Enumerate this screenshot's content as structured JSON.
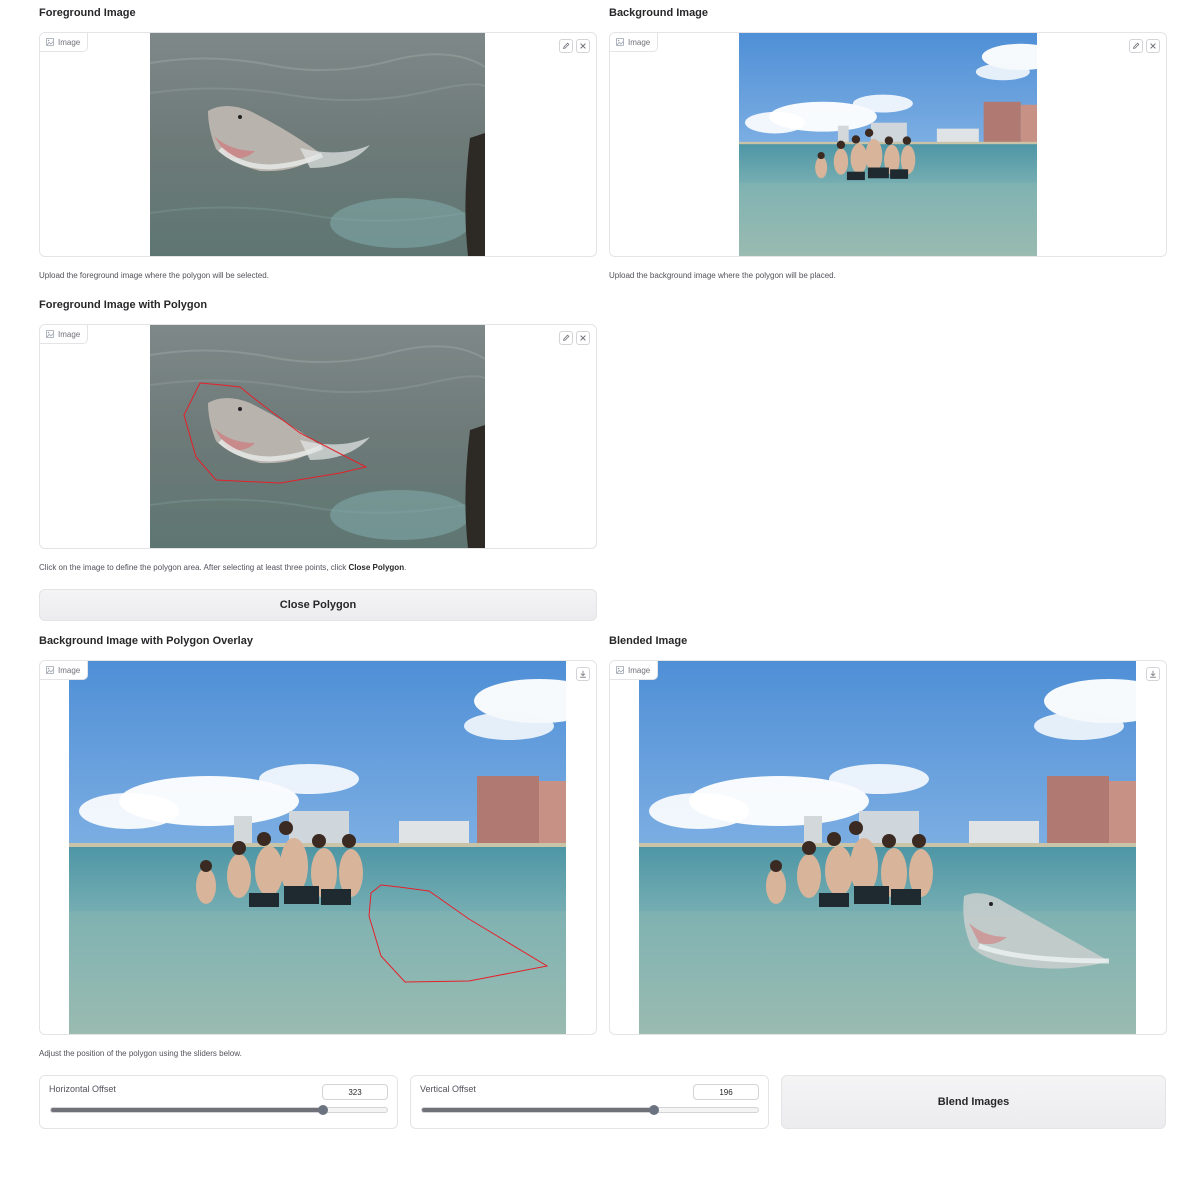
{
  "foreground": {
    "label": "Foreground Image",
    "badge": "Image",
    "hint": "Upload the foreground image where the polygon will be selected."
  },
  "background": {
    "label": "Background Image",
    "badge": "Image",
    "hint": "Upload the background image where the polygon will be placed."
  },
  "polygon_panel": {
    "label": "Foreground Image with Polygon",
    "badge": "Image",
    "hint_prefix": "Click on the image to define the polygon area. After selecting at least three points, click ",
    "hint_bold": "Close Polygon",
    "hint_suffix": "."
  },
  "close_polygon_button": "Close Polygon",
  "overlay_panel": {
    "label": "Background Image with Polygon Overlay",
    "badge": "Image"
  },
  "blended_panel": {
    "label": "Blended Image",
    "badge": "Image"
  },
  "slider_hint": "Adjust the position of the polygon using the sliders below.",
  "horizontal_offset": {
    "label": "Horizontal Offset",
    "value": "323",
    "fraction": 0.81
  },
  "vertical_offset": {
    "label": "Vertical Offset",
    "value": "196",
    "fraction": 0.69
  },
  "blend_button": "Blend Images",
  "colors": {
    "polygon": "#e5202a",
    "accent": "#71717a"
  },
  "icons": [
    "image-icon",
    "edit-icon",
    "close-icon",
    "download-icon"
  ]
}
